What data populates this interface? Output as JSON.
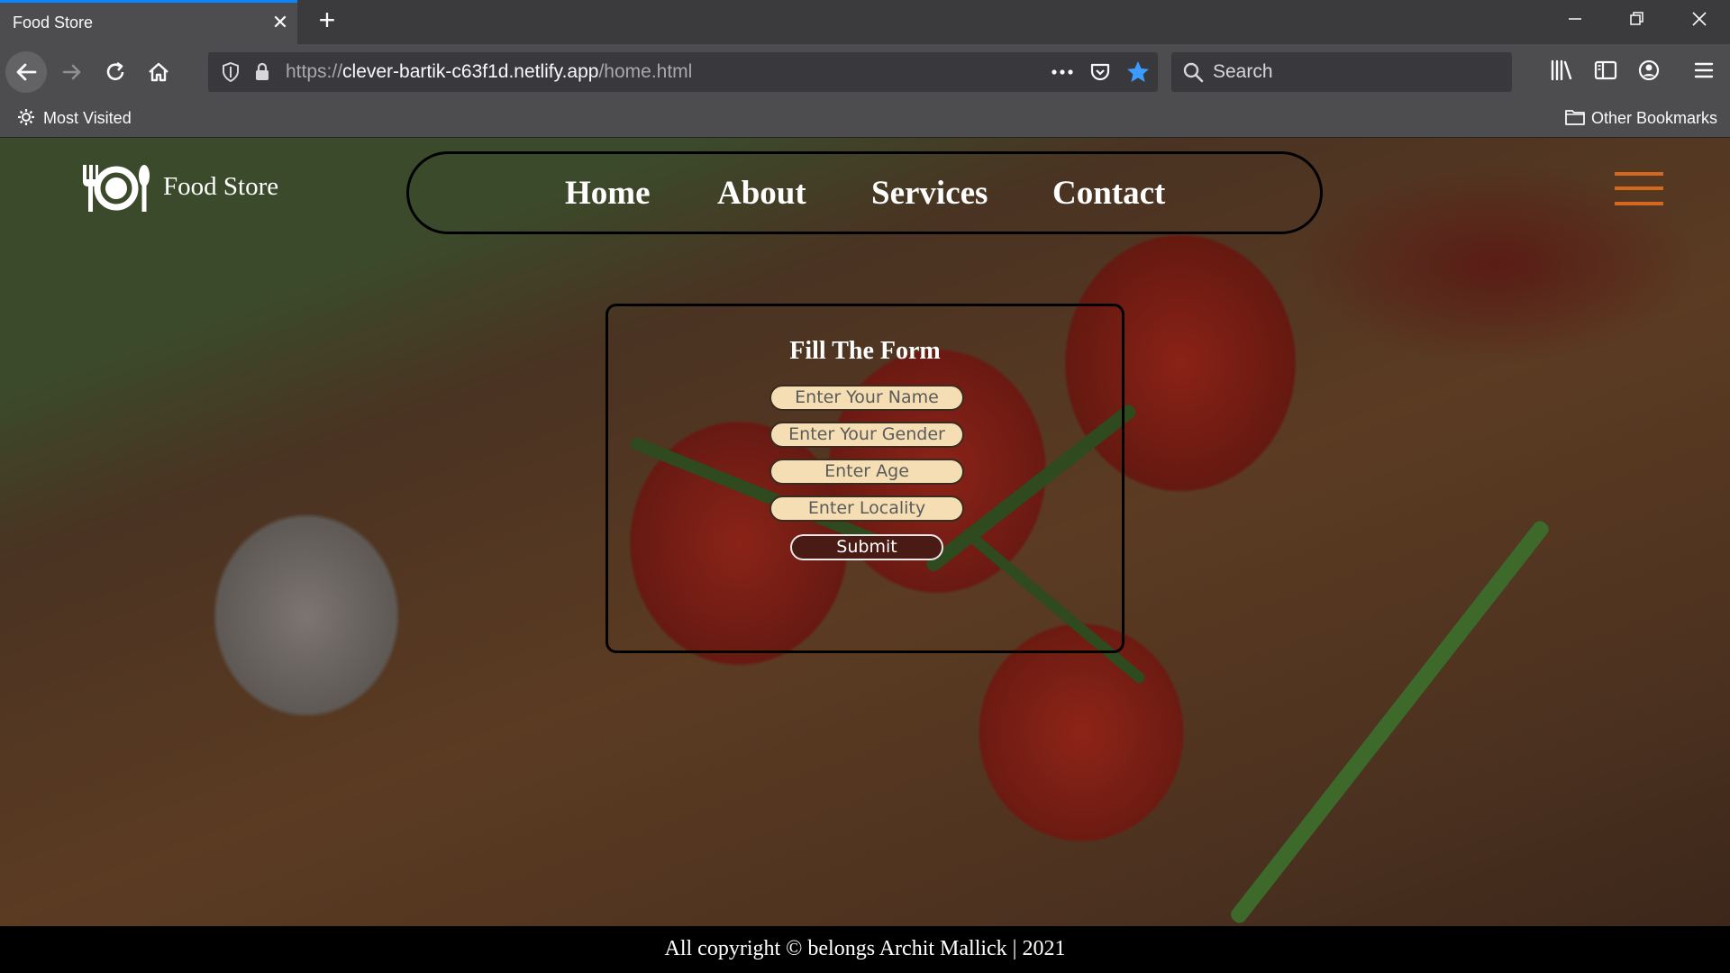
{
  "browser": {
    "tab_title": "Food Store",
    "tab_close": "✕",
    "new_tab": "+",
    "url_scheme": "https://",
    "url_host": "clever-bartik-c63f1d.netlify.app",
    "url_path": "/home.html",
    "search_placeholder": "Search",
    "bookmark_left": "Most Visited",
    "bookmark_right": "Other Bookmarks",
    "accent": "#0a84ff"
  },
  "site": {
    "brand": "Food Store",
    "nav": [
      "Home",
      "About",
      "Services",
      "Contact"
    ],
    "hamburger_color": "#d2691e"
  },
  "form": {
    "title": "Fill The Form",
    "fields": [
      "Enter Your Name",
      "Enter Your Gender",
      "Enter Age",
      "Enter Locality"
    ],
    "submit": "Submit"
  },
  "footer": {
    "text": "All copyright © belongs Archit Mallick | 2021"
  }
}
